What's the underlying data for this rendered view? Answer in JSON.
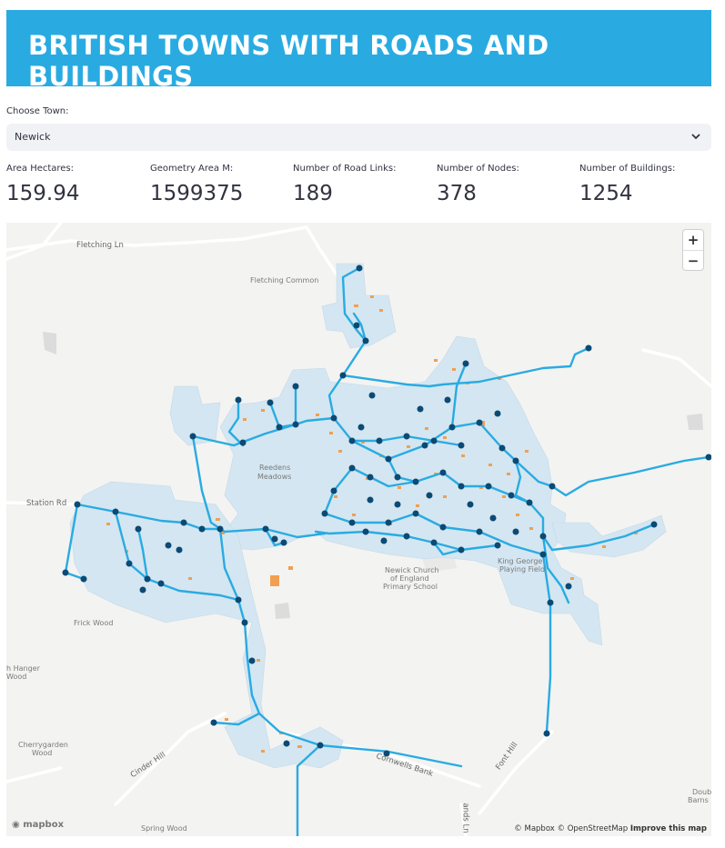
{
  "header": {
    "title": "BRITISH TOWNS WITH ROADS AND BUILDINGS"
  },
  "town_select": {
    "label": "Choose Town:",
    "value": "Newick"
  },
  "metrics": [
    {
      "label": "Area Hectares:",
      "value": "159.94"
    },
    {
      "label": "Geometry Area M:",
      "value": "1599375"
    },
    {
      "label": "Number of Road Links:",
      "value": "189"
    },
    {
      "label": "Number of Nodes:",
      "value": "378"
    },
    {
      "label": "Number of Buildings:",
      "value": "1254"
    }
  ],
  "map": {
    "zoom_in": "+",
    "zoom_out": "−",
    "places": {
      "fletching_ln": "Fletching Ln",
      "fletching_common": "Fletching Common",
      "reedens": "Reedens",
      "meadows": "Meadows",
      "station_rd": "Station Rd",
      "frick_wood": "Frick Wood",
      "hanger": "h Hanger",
      "wood": "Wood",
      "cherrygarden": "Cherrygarden",
      "cherry_wood": "Wood",
      "cinder_hill": "Cinder Hill",
      "spring_wood": "Spring Wood",
      "church1": "Newick Church",
      "church2": "of England",
      "church3": "Primary School",
      "playing1": "King George",
      "playing2": "Playing Field",
      "cornwells": "Cornwells Bank",
      "font_hill": "Font Hill",
      "lands_ln": "ands Ln",
      "doub": "Doub",
      "barns": "Barns F"
    },
    "logo": "mapbox",
    "attribution": "© Mapbox © OpenStreetMap",
    "improve": "Improve this map",
    "colors": {
      "area": "#d4e6f1",
      "road": "#29abe2",
      "node": "#0b4a74",
      "building": "#f0a050"
    }
  }
}
